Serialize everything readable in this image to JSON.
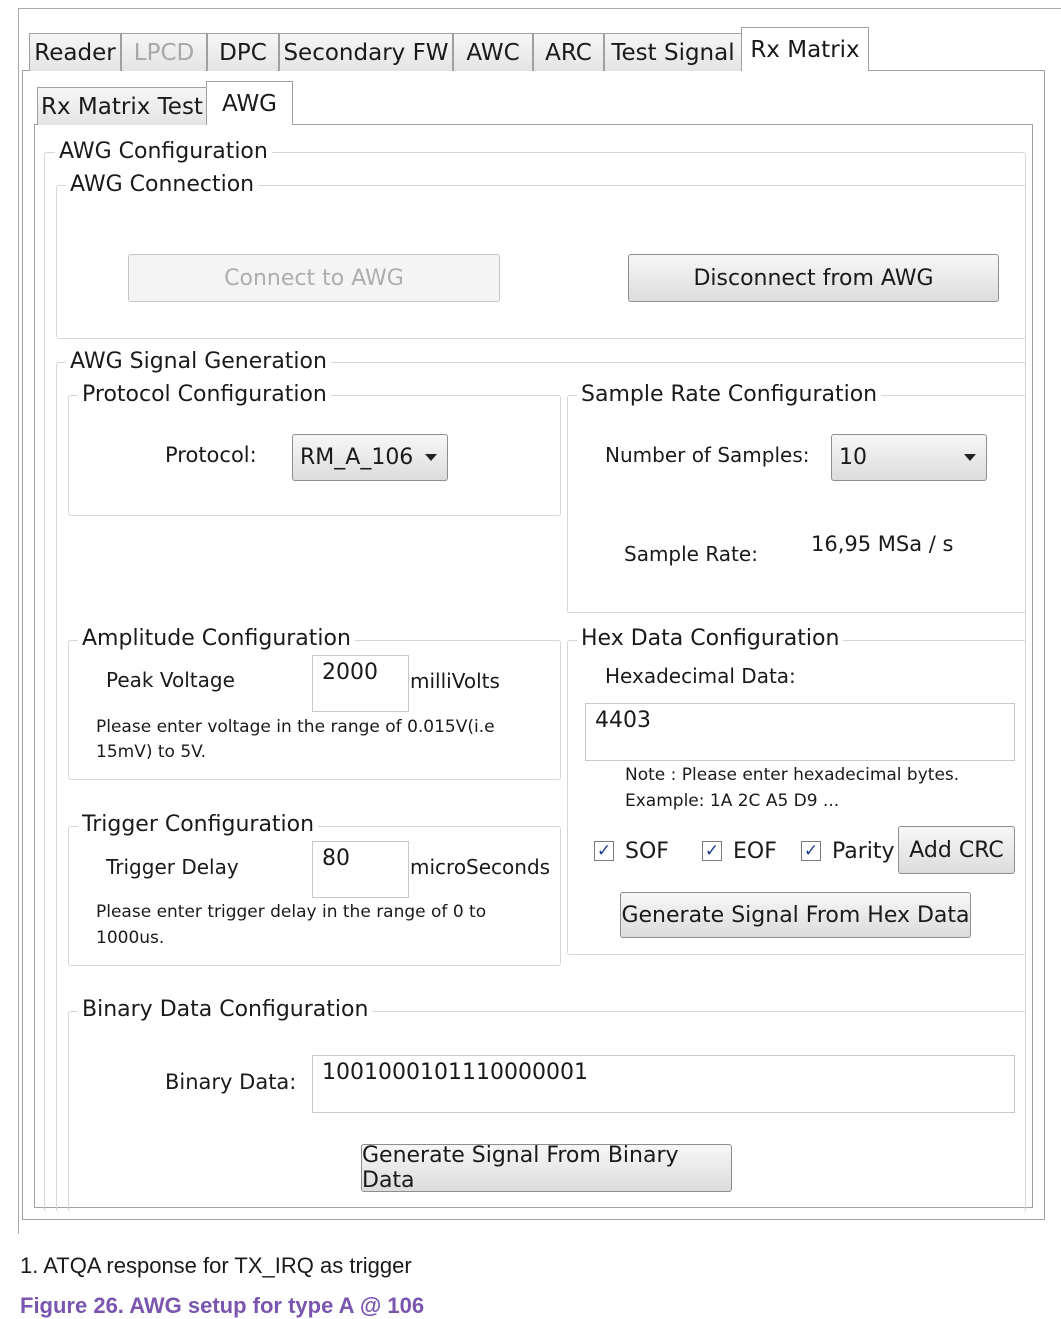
{
  "tabs_main": [
    "Reader",
    "LPCD",
    "DPC",
    "Secondary FW",
    "AWC",
    "ARC",
    "Test Signal",
    "Rx Matrix"
  ],
  "tabs_sub": [
    "Rx Matrix Test",
    "AWG"
  ],
  "awg_config": {
    "title": "AWG Configuration",
    "connection": {
      "title": "AWG Connection",
      "connect_label": "Connect to AWG",
      "disconnect_label": "Disconnect from AWG"
    },
    "signal_generation": {
      "title": "AWG Signal Generation",
      "protocol": {
        "title": "Protocol Configuration",
        "label": "Protocol:",
        "value": "RM_A_106"
      },
      "sample_rate": {
        "title": "Sample Rate Configuration",
        "samples_label": "Number of Samples:",
        "samples_value": "10",
        "rate_label": "Sample Rate:",
        "rate_value": "16,95 MSa / s"
      },
      "amplitude": {
        "title": "Amplitude Configuration",
        "label": "Peak Voltage",
        "value": "2000",
        "unit": "milliVolts",
        "hint_line1": "Please enter voltage in the range of 0.015V(i.e",
        "hint_line2": "15mV) to 5V."
      },
      "trigger": {
        "title": "Trigger Configuration",
        "label": "Trigger Delay",
        "value": "80",
        "unit": "microSeconds",
        "hint_line1": "Please enter trigger delay in the range of 0 to",
        "hint_line2": "1000us."
      },
      "hex": {
        "title": "Hex Data Configuration",
        "label": "Hexadecimal Data:",
        "value": "4403",
        "note_line1": "Note : Please enter hexadecimal bytes.",
        "note_line2": "Example: 1A 2C A5 D9 ...",
        "sof_label": "SOF",
        "sof_checked": true,
        "eof_label": "EOF",
        "eof_checked": true,
        "parity_label": "Parity",
        "parity_checked": true,
        "add_crc_label": "Add CRC",
        "generate_label": "Generate Signal From Hex Data"
      },
      "binary": {
        "title": "Binary Data Configuration",
        "label": "Binary Data:",
        "value": "1001000101110000001",
        "generate_label": "Generate Signal From Binary Data"
      }
    }
  },
  "caption": {
    "note": "1.  ATQA response for TX_IRQ as trigger",
    "figure": "Figure 26.  AWG setup for type A @ 106"
  },
  "colors": {
    "figure_caption": "#7b56b0",
    "checkmark": "#1c3f94"
  }
}
